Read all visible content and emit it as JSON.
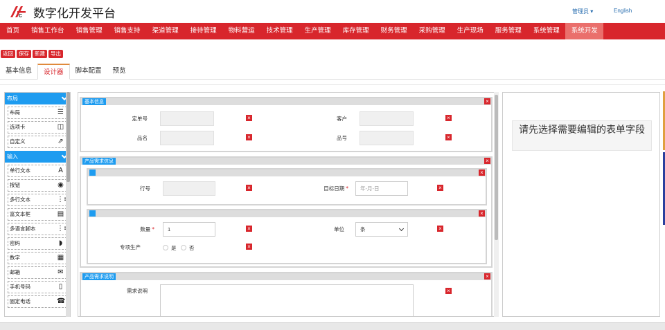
{
  "header": {
    "brand_title": "数字化开发平台",
    "user_menu": "管理员 ▾",
    "language": "English"
  },
  "nav": {
    "items": [
      {
        "label": "首页"
      },
      {
        "label": "销售工作台"
      },
      {
        "label": "销售管理"
      },
      {
        "label": "销售支持"
      },
      {
        "label": "渠道管理"
      },
      {
        "label": "接待管理"
      },
      {
        "label": "物料营运"
      },
      {
        "label": "技术管理"
      },
      {
        "label": "生产管理"
      },
      {
        "label": "库存管理"
      },
      {
        "label": "财务管理"
      },
      {
        "label": "采购管理"
      },
      {
        "label": "生产现场"
      },
      {
        "label": "服务管理"
      },
      {
        "label": "系统管理"
      },
      {
        "label": "系统开发"
      }
    ],
    "active_index": 15
  },
  "actions": {
    "back": "返回",
    "save": "保存",
    "new": "新建",
    "export": "导出"
  },
  "tabs": {
    "items": [
      {
        "label": "基本信息"
      },
      {
        "label": "设计器"
      },
      {
        "label": "脚本配置"
      },
      {
        "label": "预览"
      }
    ],
    "active_index": 1
  },
  "palette": {
    "layout_group": "布局",
    "layout_items": [
      {
        "label": "布局",
        "icon": "list-icon"
      },
      {
        "label": "选项卡",
        "icon": "tab-icon"
      },
      {
        "label": "自定义",
        "icon": "external-link-icon"
      }
    ],
    "input_group": "输入",
    "input_items": [
      {
        "label": "单行文本",
        "icon": "font-icon"
      },
      {
        "label": "按钮",
        "icon": "radio-dot-icon"
      },
      {
        "label": "多行文本",
        "icon": "list-ordered-icon"
      },
      {
        "label": "富文本框",
        "icon": "editor-icon"
      },
      {
        "label": "多语言脚本",
        "icon": "list-ordered-icon"
      },
      {
        "label": "密码",
        "icon": "shield-icon"
      },
      {
        "label": "数字",
        "icon": "calculator-icon"
      },
      {
        "label": "邮箱",
        "icon": "envelope-icon"
      },
      {
        "label": "手机号码",
        "icon": "mobile-icon"
      },
      {
        "label": "固定电话",
        "icon": "phone-icon"
      }
    ]
  },
  "designer": {
    "section_basic": {
      "label": "基本信息",
      "fields": {
        "order_no": "定单号",
        "customer": "客户",
        "product_name": "品名",
        "product_no": "品号"
      }
    },
    "section_demand": {
      "label": "产品需求信息",
      "row1": {
        "line_no": "行号",
        "target_date": "目标日期",
        "target_date_placeholder": "年-月-日"
      },
      "row2": {
        "quantity": "数量",
        "quantity_value": "1",
        "unit": "单位",
        "unit_value": "条",
        "special_production": "专项生产",
        "option_yes": "是",
        "option_no": "否"
      }
    },
    "section_desc": {
      "label": "产品需求说明",
      "field": "需求说明"
    }
  },
  "properties": {
    "message": "请先选择需要编辑的表单字段"
  },
  "colors": {
    "brand_red": "#d8262c",
    "nav_active": "#ea6f6c",
    "accent_blue": "#1e9cf0"
  }
}
